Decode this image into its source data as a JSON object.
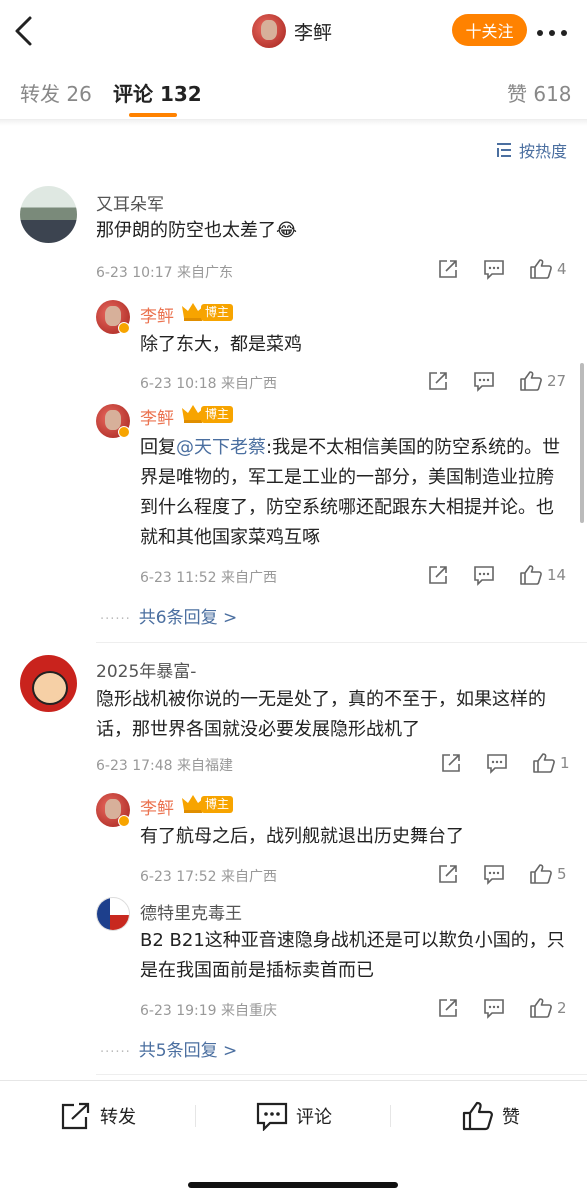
{
  "header": {
    "title": "李鲆",
    "follow_label": "十关注"
  },
  "tabs": [
    {
      "label": "转发 26"
    },
    {
      "label": "评论 132"
    },
    {
      "label": "赞 618"
    }
  ],
  "sort_label": "按热度",
  "comments": [
    {
      "user": "又耳朵军",
      "text": "那伊朗的防空也太差了",
      "emoji": "😂",
      "meta": "6-23 10:17 来自广东",
      "likes": "4",
      "replies": [
        {
          "user": "李鲆",
          "badge": "博主",
          "text": "除了东大，都是菜鸡",
          "meta": "6-23 10:18 来自广西",
          "likes": "27"
        },
        {
          "user": "李鲆",
          "badge": "博主",
          "reply_prefix": "回复",
          "mention": "@天下老蔡",
          "text": ":我是不太相信美国的防空系统的。世界是唯物的，军工是工业的一部分，美国制造业拉胯到什么程度了，防空系统哪还配跟东大相提并论。也就和其他国家菜鸡互啄",
          "meta": "6-23 11:52 来自广西",
          "likes": "14"
        }
      ],
      "more_replies": "共6条回复 >"
    },
    {
      "user": "2025年暴富-",
      "text": "隐形战机被你说的一无是处了，真的不至于，如果这样的话，那世界各国就没必要发展隐形战机了",
      "meta": "6-23 17:48 来自福建",
      "likes": "1",
      "replies": [
        {
          "user": "李鲆",
          "badge": "博主",
          "text": "有了航母之后，战列舰就退出历史舞台了",
          "meta": "6-23 17:52 来自广西",
          "likes": "5"
        },
        {
          "user": "德特里克毒王",
          "text": "B2 B21这种亚音速隐身战机还是可以欺负小国的，只是在我国面前是插标卖首而已",
          "meta": "6-23 19:19 来自重庆",
          "likes": "2"
        }
      ],
      "more_replies": "共5条回复 >"
    }
  ],
  "bottom_bar": {
    "forward": "转发",
    "comment": "评论",
    "like": "赞"
  },
  "colors": {
    "accent": "#ff8200",
    "link": "#4b6fa0",
    "author_name": "#eb7350"
  }
}
